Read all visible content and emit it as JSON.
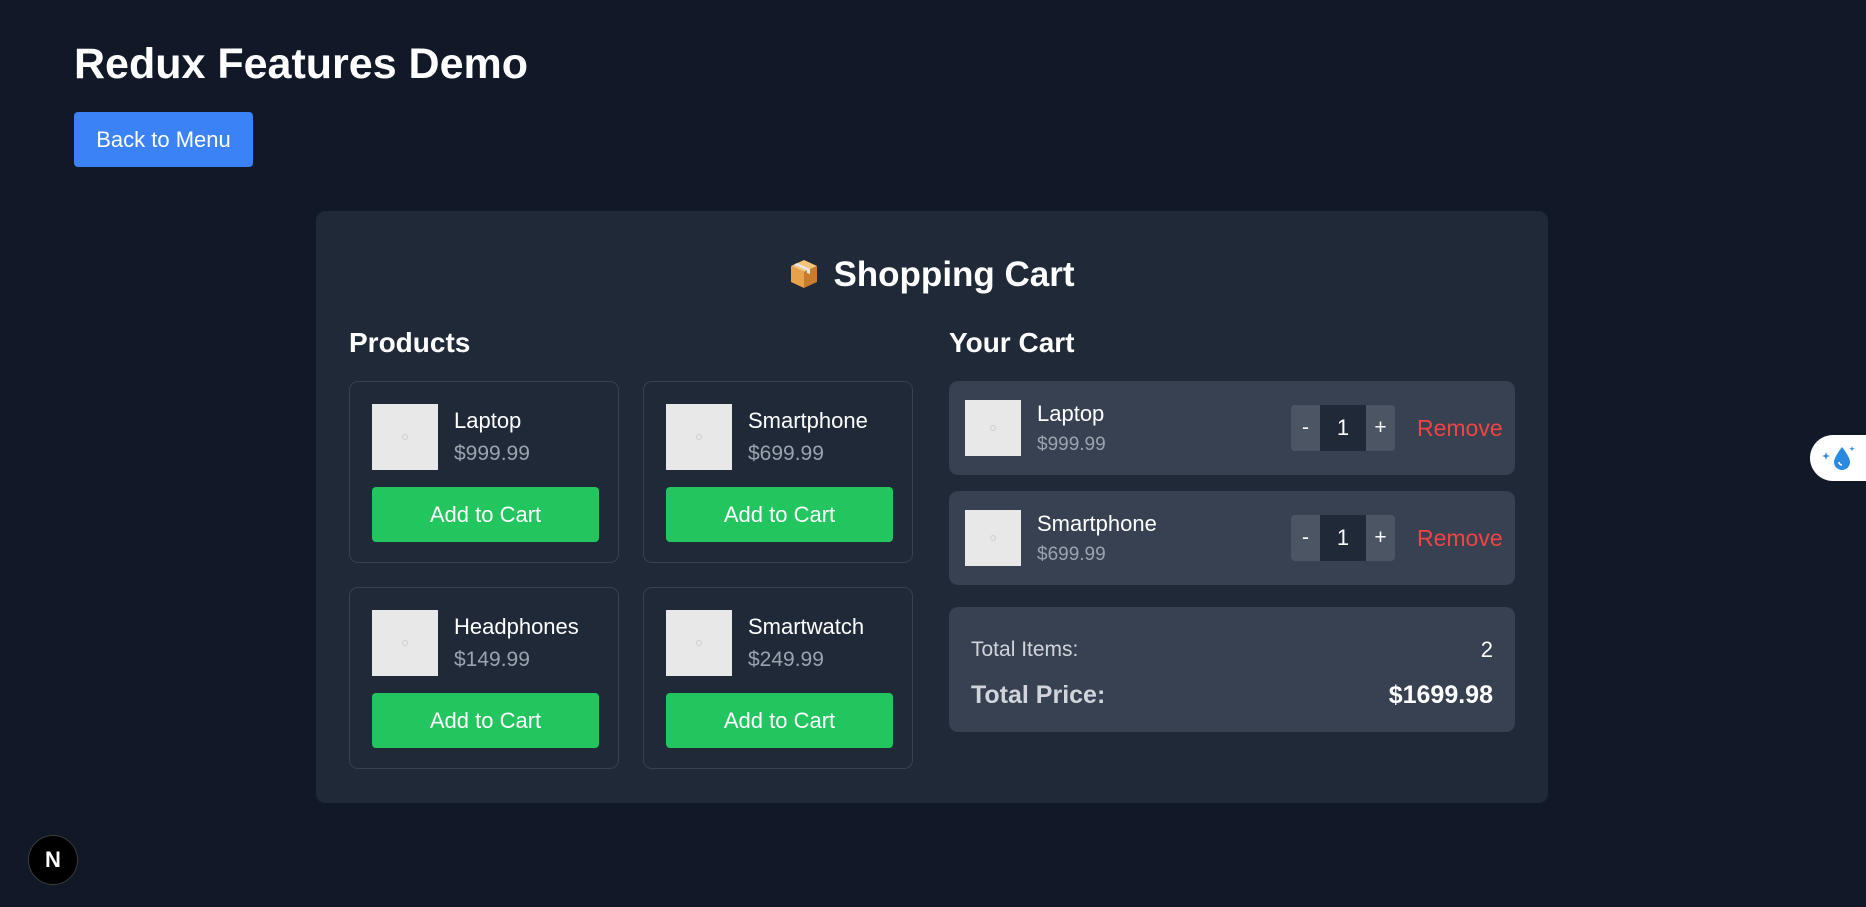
{
  "header": {
    "title": "Redux Features Demo",
    "back_label": "Back to Menu"
  },
  "cart_panel": {
    "title": "Shopping Cart",
    "title_icon": "package-icon"
  },
  "products_section": {
    "title": "Products",
    "items": [
      {
        "name": "Laptop",
        "price": "$999.99",
        "button": "Add to Cart"
      },
      {
        "name": "Smartphone",
        "price": "$699.99",
        "button": "Add to Cart"
      },
      {
        "name": "Headphones",
        "price": "$149.99",
        "button": "Add to Cart"
      },
      {
        "name": "Smartwatch",
        "price": "$249.99",
        "button": "Add to Cart"
      }
    ]
  },
  "cart_section": {
    "title": "Your Cart",
    "items": [
      {
        "name": "Laptop",
        "price": "$999.99",
        "quantity": "1",
        "decrement": "-",
        "increment": "+",
        "remove": "Remove"
      },
      {
        "name": "Smartphone",
        "price": "$699.99",
        "quantity": "1",
        "decrement": "-",
        "increment": "+",
        "remove": "Remove"
      }
    ],
    "summary": {
      "items_label": "Total Items:",
      "items_value": "2",
      "price_label": "Total Price:",
      "price_value": "$1699.98"
    }
  },
  "dev_badge": {
    "label": "N",
    "icon": "nextjs-logo-icon"
  },
  "extension_widget": {
    "icon": "water-drop-sparkle-icon"
  },
  "colors": {
    "background": "#111827",
    "panel": "#1f2937",
    "card": "#374151",
    "primary_button": "#3b82f6",
    "add_button": "#22c55e",
    "remove_text": "#ef4444",
    "muted_text": "#9ca3af"
  }
}
